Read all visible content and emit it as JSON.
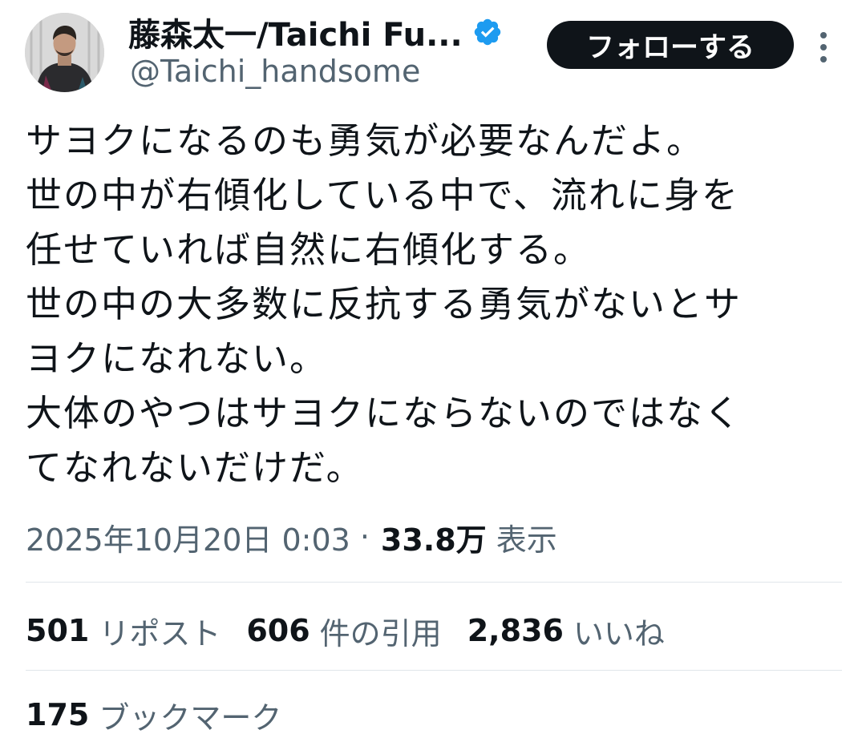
{
  "author": {
    "display_name": "藤森太一/Taichi Fu...",
    "handle": "@Taichi_handsome",
    "verified_icon": "verified-badge-icon",
    "verified_color": "#1d9bf0"
  },
  "actions": {
    "follow_label": "フォローする",
    "more_icon": "more-vertical-icon"
  },
  "tweet": {
    "lines": [
      "サヨクになるのも勇気が必要なんだよ。",
      "世の中が右傾化している中で、流れに身を",
      "任せていれば自然に右傾化する。",
      "世の中の大多数に反抗する勇気がないとサ",
      "ヨクになれない。",
      "大体のやつはサヨクにならないのではなく",
      "てなれないだけだ。"
    ]
  },
  "meta": {
    "timestamp": "2025年10月20日 0:03",
    "separator": "·",
    "views_count": "33.8万",
    "views_label": "表示"
  },
  "stats": {
    "reposts_count": "501",
    "reposts_label": "リポスト",
    "quotes_count": "606",
    "quotes_label": "件の引用",
    "likes_count": "2,836",
    "likes_label": "いいね",
    "bookmarks_count": "175",
    "bookmarks_label": "ブックマーク"
  },
  "colors": {
    "text_primary": "#0f1419",
    "text_secondary": "#536471",
    "button_bg": "#0f1419",
    "divider": "#e1e6ea"
  }
}
